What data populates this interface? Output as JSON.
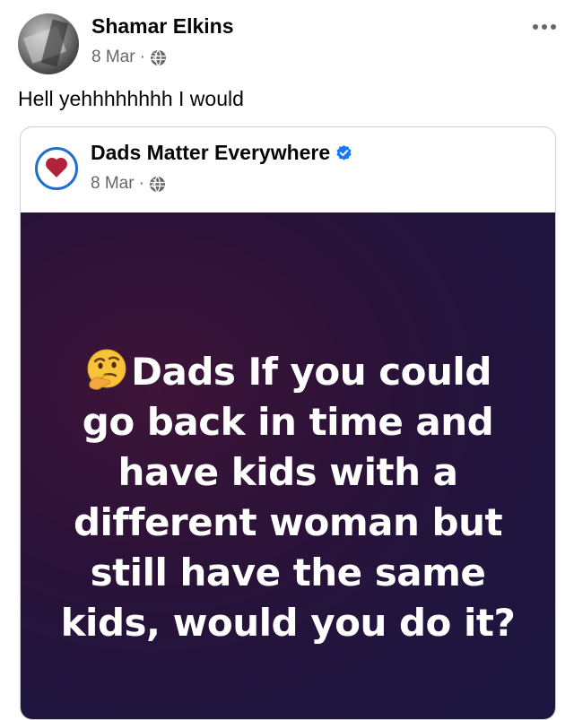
{
  "post": {
    "author": "Shamar Elkins",
    "date": "8 Mar",
    "separator": "·",
    "audience_icon": "globe-icon",
    "more_icon": "more-options-icon",
    "text": "Hell yehhhhhhhh I would"
  },
  "shared_post": {
    "page_name": "Dads Matter Everywhere",
    "verified_icon": "verified-badge-icon",
    "date": "8 Mar",
    "separator": "·",
    "audience_icon": "globe-icon",
    "image_text": "Dads If you could go back in time and have kids with a different woman but still have the same kids, would you do it?",
    "image_lines": [
      "Dads If you could",
      "go back in time and",
      "have kids with a",
      "different woman but",
      "still have the same",
      "kids, would you do it?"
    ],
    "emoji_icon": "thinking-face-emoji",
    "colors": {
      "background_dark": "#1b1640",
      "background_accent": "#3e1438",
      "verified_blue": "#1877f2"
    }
  }
}
